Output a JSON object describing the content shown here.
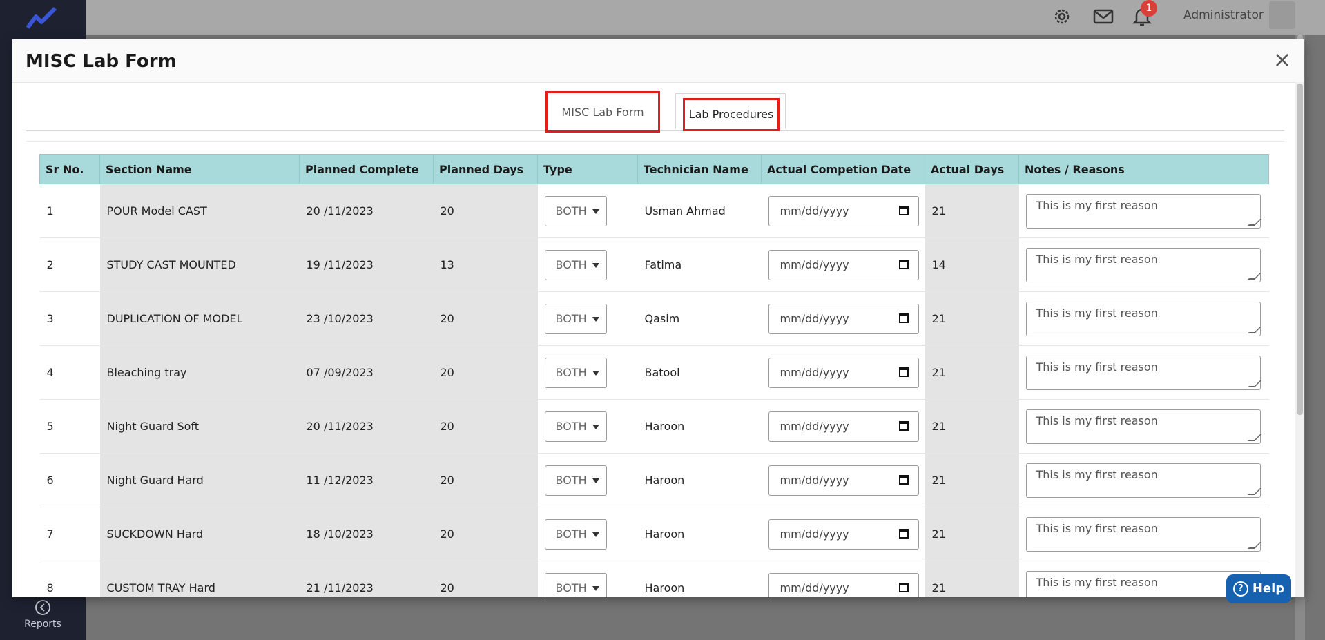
{
  "app": {
    "admin_name": "Administrator",
    "notification_count": "1",
    "sidebar_reports_label": "Reports"
  },
  "modal": {
    "title": "MISC Lab Form",
    "close_label": "×",
    "tabs": [
      {
        "label": "MISC Lab Form"
      },
      {
        "label": "Lab Procedures"
      }
    ]
  },
  "table": {
    "headers": [
      "Sr No.",
      "Section Name",
      "Planned Complete",
      "Planned Days",
      "Type",
      "Technician Name",
      "Actual Competion Date",
      "Actual Days",
      "Notes / Reasons"
    ],
    "rows": [
      {
        "sr": "1",
        "section": "POUR Model CAST",
        "planned_complete": "20 /11/2023",
        "planned_days": "20",
        "type": "BOTH",
        "technician": "Usman Ahmad",
        "actual_date": "mm/dd/yyyy",
        "actual_days": "21",
        "notes": "This is my first reason"
      },
      {
        "sr": "2",
        "section": "STUDY CAST MOUNTED",
        "planned_complete": "19 /11/2023",
        "planned_days": "13",
        "type": "BOTH",
        "technician": "Fatima",
        "actual_date": "mm/dd/yyyy",
        "actual_days": "14",
        "notes": "This is my first reason"
      },
      {
        "sr": "3",
        "section": "DUPLICATION OF MODEL",
        "planned_complete": "23 /10/2023",
        "planned_days": "20",
        "type": "BOTH",
        "technician": "Qasim",
        "actual_date": "mm/dd/yyyy",
        "actual_days": "21",
        "notes": "This is my first reason"
      },
      {
        "sr": "4",
        "section": "Bleaching tray",
        "planned_complete": "07 /09/2023",
        "planned_days": "20",
        "type": "BOTH",
        "technician": "Batool",
        "actual_date": "mm/dd/yyyy",
        "actual_days": "21",
        "notes": "This is my first reason"
      },
      {
        "sr": "5",
        "section": "Night Guard Soft",
        "planned_complete": "20 /11/2023",
        "planned_days": "20",
        "type": "BOTH",
        "technician": "Haroon",
        "actual_date": "mm/dd/yyyy",
        "actual_days": "21",
        "notes": "This is my first reason"
      },
      {
        "sr": "6",
        "section": "Night Guard Hard",
        "planned_complete": "11 /12/2023",
        "planned_days": "20",
        "type": "BOTH",
        "technician": "Haroon",
        "actual_date": "mm/dd/yyyy",
        "actual_days": "21",
        "notes": "This is my first reason"
      },
      {
        "sr": "7",
        "section": "SUCKDOWN Hard",
        "planned_complete": "18 /10/2023",
        "planned_days": "20",
        "type": "BOTH",
        "technician": "Haroon",
        "actual_date": "mm/dd/yyyy",
        "actual_days": "21",
        "notes": "This is my first reason"
      },
      {
        "sr": "8",
        "section": "CUSTOM TRAY Hard",
        "planned_complete": "21 /11/2023",
        "planned_days": "20",
        "type": "BOTH",
        "technician": "Haroon",
        "actual_date": "mm/dd/yyyy",
        "actual_days": "21",
        "notes": "This is my first reason"
      }
    ]
  },
  "help": {
    "label": "Help"
  },
  "icons": {
    "settings": "gear-icon",
    "mail": "mail-icon",
    "bell": "bell-icon",
    "help": "help-circle-icon",
    "calendar": "calendar-icon",
    "reports": "reports-icon"
  },
  "colors": {
    "header_bg": "#a8dadc",
    "highlight_border": "#e51c1c",
    "help_bg": "#1762b0"
  }
}
